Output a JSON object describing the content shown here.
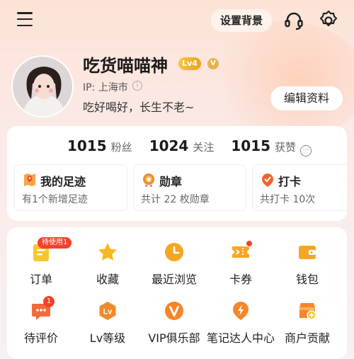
{
  "topbar": {
    "set_background_label": "设置背景",
    "icons": [
      "menu-icon",
      "headset-icon",
      "settings-gear-icon"
    ]
  },
  "profile": {
    "nickname": "吃货喵喵神",
    "level_badge": "Lv4",
    "verified_badge": "V",
    "ip_label": "IP: 上海市",
    "bio": "吃好喝好，长生不老~",
    "edit_button": "编辑资料"
  },
  "stats": [
    {
      "value": "1015",
      "label": "粉丝"
    },
    {
      "value": "1024",
      "label": "关注"
    },
    {
      "value": "1015",
      "label": "获赞"
    }
  ],
  "subcards": [
    {
      "title": "我的足迹",
      "desc": "有1个新增足迹",
      "icon": "map-pin-icon"
    },
    {
      "title": "勋章",
      "desc": "共计 22 枚勋章",
      "icon": "medal-icon"
    },
    {
      "title": "打卡",
      "desc": "共打卡 10次",
      "icon": "checkin-icon"
    }
  ],
  "services": [
    {
      "label": "订单",
      "icon": "order-icon",
      "badge": "待使用1"
    },
    {
      "label": "收藏",
      "icon": "star-icon"
    },
    {
      "label": "最近浏览",
      "icon": "clock-icon"
    },
    {
      "label": "卡券",
      "icon": "coupon-icon",
      "dot": true
    },
    {
      "label": "钱包",
      "icon": "wallet-icon"
    },
    {
      "label": "待评价",
      "icon": "comment-icon",
      "badge": "1"
    },
    {
      "label": "Lv等级",
      "icon": "level-icon"
    },
    {
      "label": "VIP俱乐部",
      "icon": "vip-icon"
    },
    {
      "label": "笔记达人中心",
      "icon": "lightning-icon"
    },
    {
      "label": "商户贡献",
      "icon": "shop-contribution-icon"
    }
  ],
  "colors": {
    "accent": "#f58a1f",
    "badge_red": "#f5402c"
  }
}
